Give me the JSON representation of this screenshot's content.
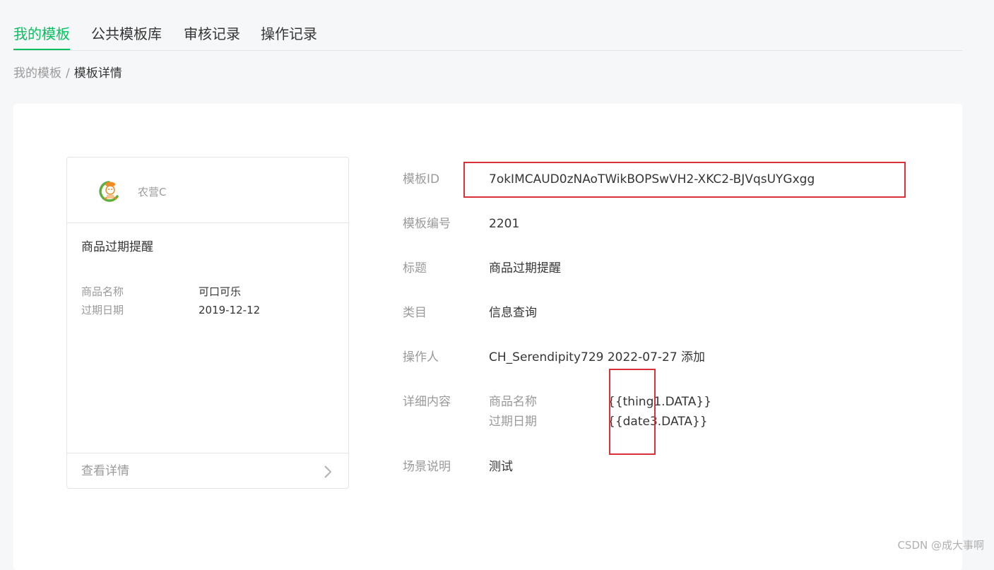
{
  "tabs": [
    {
      "label": "我的模板",
      "active": true
    },
    {
      "label": "公共模板库",
      "active": false
    },
    {
      "label": "审核记录",
      "active": false
    },
    {
      "label": "操作记录",
      "active": false
    }
  ],
  "breadcrumb": {
    "parent": "我的模板",
    "separator": "/",
    "current": "模板详情"
  },
  "preview": {
    "account_name": "农营C",
    "title": "商品过期提醒",
    "fields": [
      {
        "label": "商品名称",
        "value": "可口可乐"
      },
      {
        "label": "过期日期",
        "value": "2019-12-12"
      }
    ],
    "footer_label": "查看详情"
  },
  "details": {
    "template_id_label": "模板ID",
    "template_id": "7okIMCAUD0zNAoTWikBOPSwVH2-XKC2-BJVqsUYGxgg",
    "number_label": "模板编号",
    "number": "2201",
    "title_label": "标题",
    "title": "商品过期提醒",
    "category_label": "类目",
    "category": "信息查询",
    "operator_label": "操作人",
    "operator": "CH_Serendipity729 2022-07-27 添加",
    "content_label": "详细内容",
    "content": [
      {
        "label": "商品名称",
        "value": "{{thing1.DATA}}"
      },
      {
        "label": "过期日期",
        "value": "{{date3.DATA}}"
      }
    ],
    "scene_label": "场景说明",
    "scene": "测试"
  },
  "watermark": "CSDN @成大事啊",
  "colors": {
    "accent": "#07c160",
    "highlight": "#d9303a"
  }
}
